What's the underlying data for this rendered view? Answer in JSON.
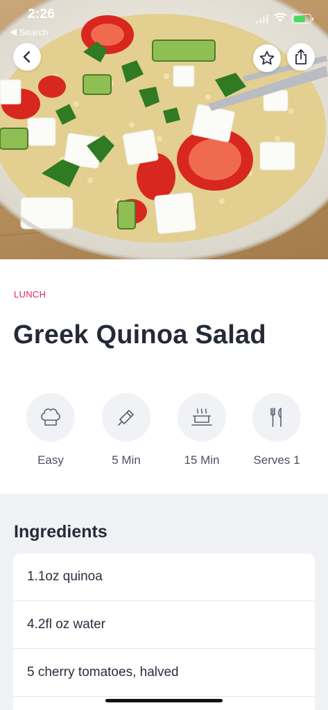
{
  "status_bar": {
    "time": "2:26",
    "back_app": "Search"
  },
  "hero": {
    "image": "greek-quinoa-salad-photo"
  },
  "recipe": {
    "category": "LUNCH",
    "title": "Greek Quinoa Salad"
  },
  "stats": [
    {
      "icon": "chef-hat-icon",
      "label": "Easy"
    },
    {
      "icon": "knife-icon",
      "label": "5 Min"
    },
    {
      "icon": "cooking-pot-icon",
      "label": "15 Min"
    },
    {
      "icon": "fork-knife-icon",
      "label": "Serves 1"
    }
  ],
  "ingredients": {
    "title": "Ingredients",
    "items": [
      "1.1oz quinoa",
      "4.2fl oz water",
      "5 cherry tomatoes, halved",
      ""
    ]
  },
  "colors": {
    "accent": "#e0236f",
    "text": "#262a38",
    "section_bg": "#f1f2f6"
  }
}
